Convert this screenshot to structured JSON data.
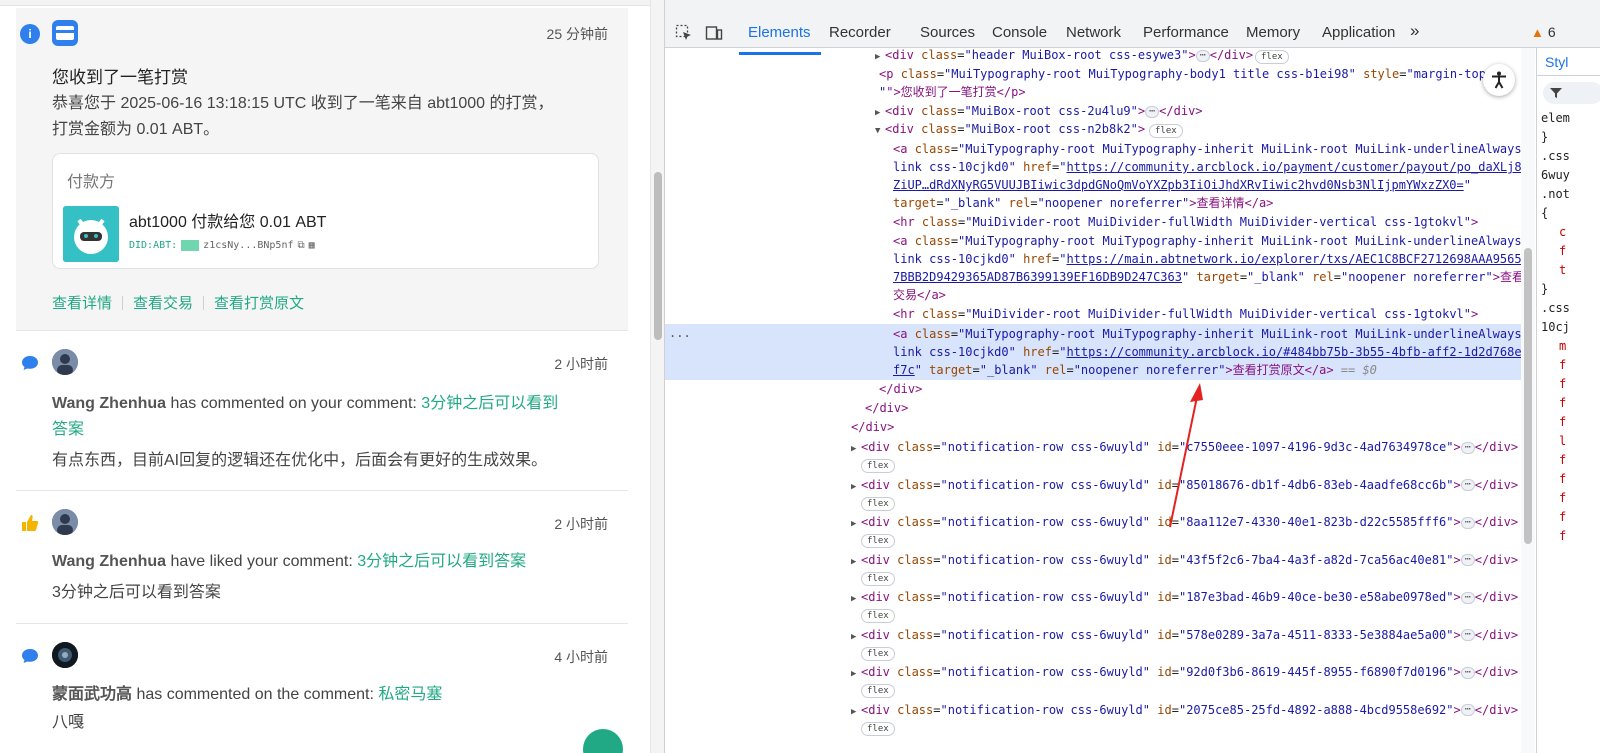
{
  "notifications": {
    "first": {
      "time": "25 分钟前",
      "title": "您收到了一笔打赏",
      "body_1": "恭喜您于 2025-06-16 13:18:15 UTC 收到了一笔来自 abt1000 的打赏，",
      "body_2": "打赏金额为 0.01 ABT。",
      "payer_label": "付款方",
      "payer_line": "abt1000 付款给您 0.01 ABT",
      "did_prefix": "DID:ABT:",
      "did_value": "z1csNy...BNp5nf",
      "links": [
        "查看详情",
        "查看交易",
        "查看打赏原文"
      ]
    },
    "second": {
      "time": "2 小时前",
      "user": "Wang Zhenhua",
      "action": " has commented on your comment: ",
      "target_1": "3分钟之后可以看到",
      "target_2": "答案",
      "body": "有点东西，目前AI回复的逻辑还在优化中，后面会有更好的生成效果。"
    },
    "third": {
      "time": "2 小时前",
      "user": "Wang Zhenhua",
      "action": " have liked your comment: ",
      "target": "3分钟之后可以看到答案",
      "body": "3分钟之后可以看到答案"
    },
    "fourth": {
      "time": "4 小时前",
      "user": "蒙面武功高",
      "action": " has commented on the comment: ",
      "target": "私密马塞",
      "body": "八嘎"
    }
  },
  "devtools": {
    "tabs": [
      "Elements",
      "Recorder",
      "Sources",
      "Console",
      "Network",
      "Performance",
      "Memory",
      "Application"
    ],
    "more_tabs": "»",
    "warning_count": "6",
    "styles_tab": "Styl",
    "styles_lines": [
      "elem",
      "}",
      ".css",
      "6wuy",
      ".not",
      "{",
      "c",
      "f",
      "t",
      "}",
      ".css",
      "10cj",
      "m",
      "f",
      "f",
      "f",
      "f",
      "l",
      "f",
      "f",
      "f",
      "f",
      "f"
    ],
    "badge_flex": "flex",
    "ellipsis": "⋯",
    "selected_marker": "...",
    "dom_eq": "== $0",
    "lines": {
      "l1_a": "<div ",
      "l1_b": "class",
      "l1_c": "=\"",
      "l1_d": "header MuiBox-root css-esywe3",
      "l1_e": "\">",
      "l1_f": "</div>",
      "l2_a": "<p ",
      "l2_b": "class",
      "l2_d": "MuiTypography-root MuiTypography-body1 title css-b1ei98",
      "l2_g": "style",
      "l2_h": "\"margin-top:",
      "l3_a": "\">您收到了一笔打赏</p>",
      "l4_d": "MuiBox-root css-2u4lu9",
      "l5_d": "MuiBox-root css-n2b8k2",
      "a_class_1": "MuiTypography-root MuiTypography-inherit MuiLink-root MuiLink-underlineAlways",
      "a_class_2": "link css-10cjkd0",
      "href1_a": "https://community.arcblock.io/payment/customer/payout/po_daXLj8o",
      "href1_b": "ZiUP…dRdXNyRG5VUUJBIiwic3dpdGNoQmVoYXZpb3IiOiJhdXRvIiwic2hvd0Nsb3NlIjpmYWxzZX0=",
      "target_blank": "\"_blank\"",
      "rel": "\"noopener noreferrer\"",
      "text_1": ">查看详情</a>",
      "hr_class": "MuiDivider-root MuiDivider-fullWidth MuiDivider-vertical css-1gtokvl",
      "href2_a": "https://main.abtnetwork.io/explorer/txs/AEC1C8BCF2712698AAA95659",
      "href2_b": "7BBB2D9429365AD87B6399139EF16DB9D247C363",
      "text_2a": ">查看",
      "text_2b": "交易</a>",
      "href3_a": "https://community.arcblock.io/#484bb75b-3b55-4bfb-aff2-1d2d768e7",
      "href3_b": "f7c",
      "text_3": ">查看打赏原文</a>",
      "close_div": "</div>"
    },
    "rows": [
      "c7550eee-1097-4196-9d3c-4ad7634978ce",
      "85018676-db1f-4db6-83eb-4aadfe68cc6b",
      "8aa112e7-4330-40e1-823b-d22c5585fff6",
      "43f5f2c6-7ba4-4a3f-a82d-7ca56ac40e81",
      "187e3bad-46b9-40ce-be30-e58abe0978ed",
      "578e0289-3a7a-4511-8333-5e3884ae5a00",
      "92d0f3b6-8619-445f-8955-f6890f7d0196",
      "2075ce85-25fd-4892-a888-4bcd9558e692"
    ],
    "row_class": "notification-row css-6wuyld"
  }
}
